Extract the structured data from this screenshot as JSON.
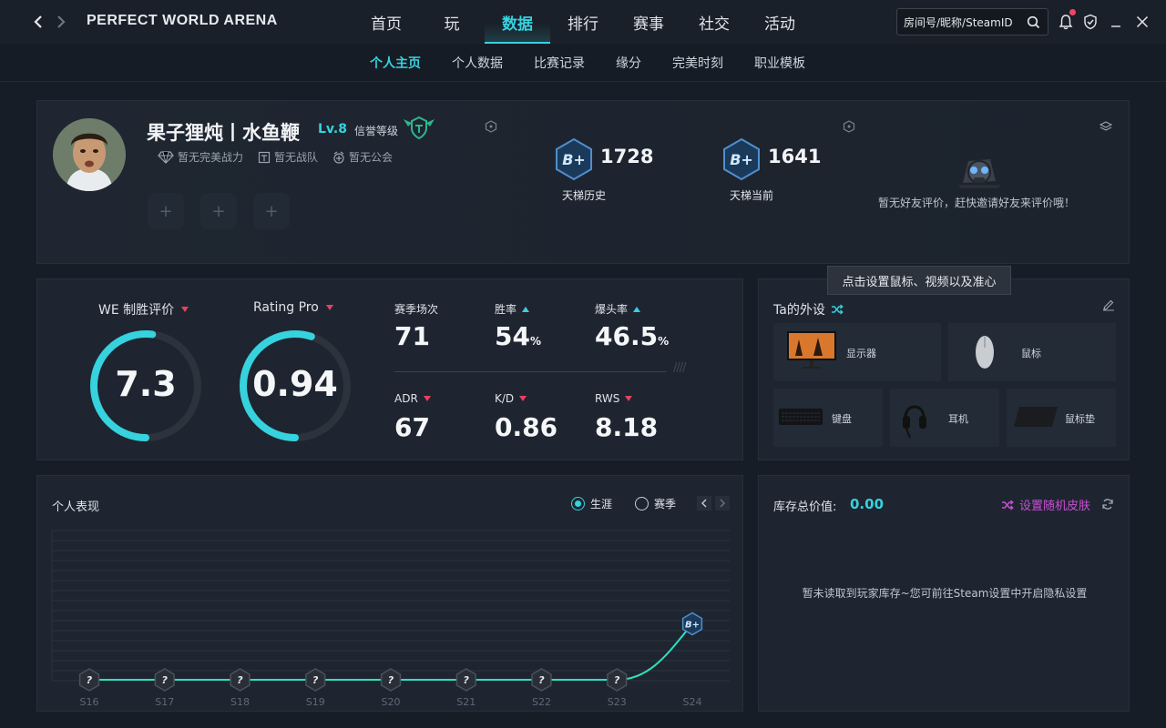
{
  "app": {
    "brand": "PERFECT WORLD ARENA"
  },
  "main_tabs": [
    "首页",
    "玩",
    "数据",
    "排行",
    "赛事",
    "社交",
    "活动"
  ],
  "main_tab_active": "数据",
  "search": {
    "placeholder": "房间号/昵称/SteamID"
  },
  "sub_tabs": [
    "个人主页",
    "个人数据",
    "比赛记录",
    "缘分",
    "完美时刻",
    "职业模板"
  ],
  "sub_tab_active": "个人主页",
  "profile": {
    "name": "果子狸炖丨水鱼鞭",
    "level": "Lv.8",
    "credit_label": "信誉等级",
    "tags": [
      "暂无完美战力",
      "暂无战队",
      "暂无公会"
    ],
    "slots": [
      "+",
      "+",
      "+"
    ],
    "rank_history": {
      "badge": "B+",
      "value": "1728",
      "label": "天梯历史"
    },
    "rank_current": {
      "badge": "B+",
      "value": "1641",
      "label": "天梯当前"
    },
    "friend_note": "暂无好友评价，赶快邀请好友来评价哦！"
  },
  "stats": {
    "we_rating": {
      "label": "WE 制胜评价",
      "value": "7.3",
      "ring_fraction": 0.52
    },
    "rating_pro": {
      "label": "Rating Pro",
      "value": "0.94",
      "ring_fraction": 0.55
    },
    "season_matches": {
      "label": "赛季场次",
      "value": "71"
    },
    "win_rate": {
      "label": "胜率",
      "value": "54",
      "unit": "%"
    },
    "headshot_rate": {
      "label": "爆头率",
      "value": "46.5",
      "unit": "%"
    },
    "adr": {
      "label": "ADR",
      "value": "67"
    },
    "kd": {
      "label": "K/D",
      "value": "0.86"
    },
    "rws": {
      "label": "RWS",
      "value": "8.18"
    },
    "colors": {
      "accent": "#36d2de",
      "down": "#e8415f",
      "ring_track": "#2c333d"
    }
  },
  "gear": {
    "title": "Ta的外设",
    "tooltip": "点击设置鼠标、视频以及准心",
    "items": [
      "显示器",
      "鼠标",
      "键盘",
      "耳机",
      "鼠标垫"
    ]
  },
  "performance": {
    "title": "个人表现",
    "options": [
      "生涯",
      "赛季"
    ],
    "selected": "生涯"
  },
  "chart_data": {
    "type": "line",
    "title": "个人表现",
    "categories": [
      "S16",
      "S17",
      "S18",
      "S19",
      "S20",
      "S21",
      "S22",
      "S23",
      "S24"
    ],
    "series": [
      {
        "values": [
          0,
          0,
          0,
          0,
          0,
          0,
          0,
          0,
          0.75
        ]
      }
    ],
    "point_badges": [
      "?",
      "?",
      "?",
      "?",
      "?",
      "?",
      "?",
      "?",
      "B+"
    ],
    "ylim": [
      0,
      1
    ],
    "grid": true
  },
  "inventory": {
    "label": "库存总价值:",
    "value": "0.00",
    "random_skin": "设置随机皮肤",
    "empty_note": "暂未读取到玩家库存~您可前往Steam设置中开启隐私设置"
  }
}
